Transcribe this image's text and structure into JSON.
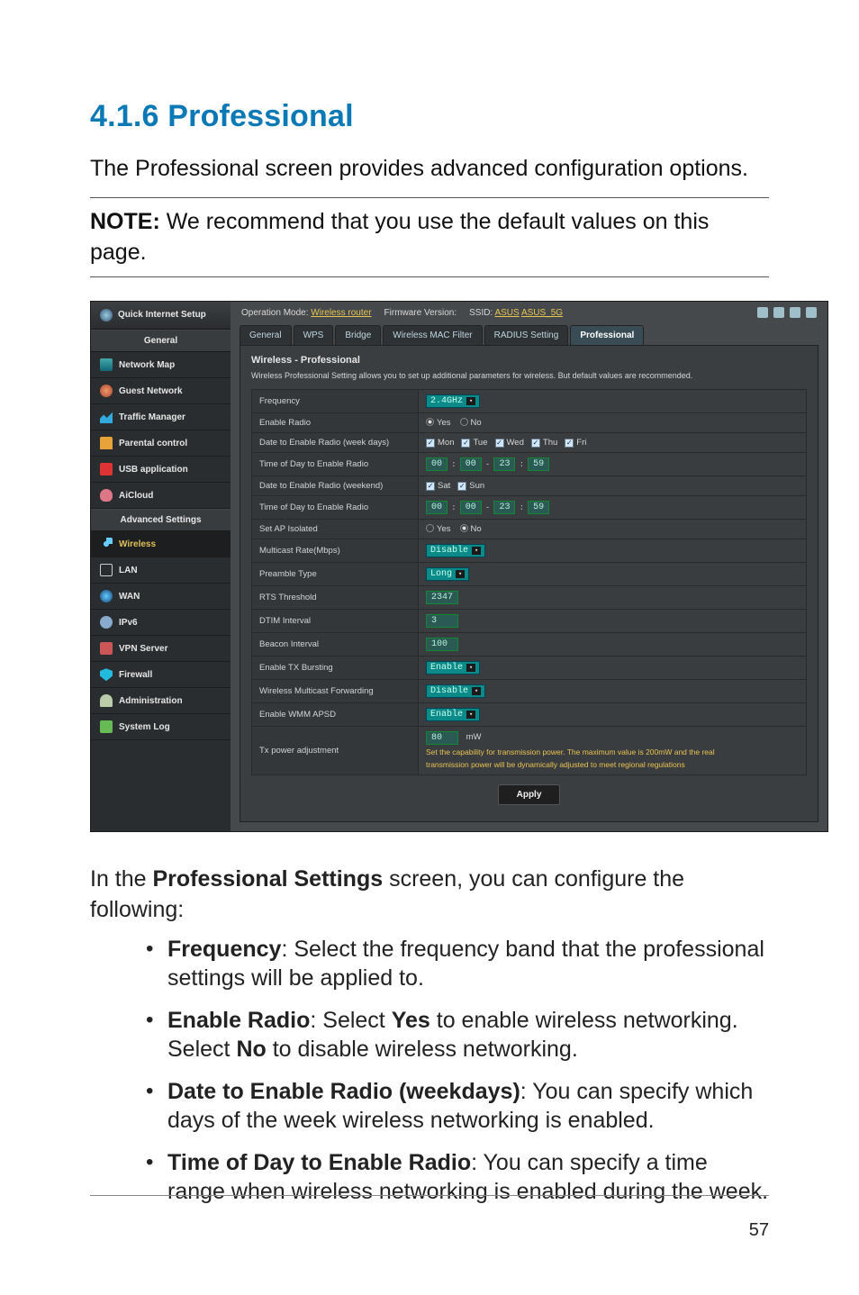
{
  "heading": "4.1.6 Professional",
  "intro": "The Professional screen provides advanced configuration options.",
  "note_label": "NOTE:",
  "note_body": "  We recommend that you use the default values on this page.",
  "page_number": "57",
  "ui": {
    "qis": "Quick Internet Setup",
    "group_general": "General",
    "group_advanced": "Advanced Settings",
    "nav": {
      "network_map": "Network Map",
      "guest_network": "Guest Network",
      "traffic_manager": "Traffic Manager",
      "parental": "Parental control",
      "usb": "USB application",
      "aicloud": "AiCloud",
      "wireless": "Wireless",
      "lan": "LAN",
      "wan": "WAN",
      "ipv6": "IPv6",
      "vpn": "VPN Server",
      "firewall": "Firewall",
      "admin": "Administration",
      "syslog": "System Log"
    },
    "top": {
      "op_mode_label": "Operation Mode:",
      "op_mode_value": "Wireless router",
      "fw_label": "Firmware Version:",
      "ssid_label": "SSID:",
      "ssid1": "ASUS",
      "ssid2": "ASUS_5G"
    },
    "tabs": {
      "general": "General",
      "wps": "WPS",
      "bridge": "Bridge",
      "macfilter": "Wireless MAC Filter",
      "radius": "RADIUS Setting",
      "professional": "Professional"
    },
    "panel_title": "Wireless - Professional",
    "panel_sub": "Wireless Professional Setting allows you to set up additional parameters for wireless. But default values are recommended.",
    "rows": {
      "frequency": {
        "label": "Frequency",
        "value": "2.4GHz"
      },
      "enable_radio": {
        "label": "Enable Radio",
        "yes": "Yes",
        "no": "No"
      },
      "date_week": {
        "label": "Date to Enable Radio (week days)",
        "mon": "Mon",
        "tue": "Tue",
        "wed": "Wed",
        "thu": "Thu",
        "fri": "Fri"
      },
      "time_week": {
        "label": "Time of Day to Enable Radio",
        "h1": "00",
        "m1": "00",
        "h2": "23",
        "m2": "59"
      },
      "date_weekend": {
        "label": "Date to Enable Radio (weekend)",
        "sat": "Sat",
        "sun": "Sun"
      },
      "time_weekend": {
        "label": "Time of Day to Enable Radio",
        "h1": "00",
        "m1": "00",
        "h2": "23",
        "m2": "59"
      },
      "ap_isolated": {
        "label": "Set AP Isolated",
        "yes": "Yes",
        "no": "No"
      },
      "multicast": {
        "label": "Multicast Rate(Mbps)",
        "value": "Disable"
      },
      "preamble": {
        "label": "Preamble Type",
        "value": "Long"
      },
      "rts": {
        "label": "RTS Threshold",
        "value": "2347"
      },
      "dtim": {
        "label": "DTIM Interval",
        "value": "3"
      },
      "beacon": {
        "label": "Beacon Interval",
        "value": "100"
      },
      "txburst": {
        "label": "Enable TX Bursting",
        "value": "Enable"
      },
      "wmf": {
        "label": "Wireless Multicast Forwarding",
        "value": "Disable"
      },
      "wmmapsd": {
        "label": "Enable WMM APSD",
        "value": "Enable"
      },
      "txpower": {
        "label": "Tx power adjustment",
        "value": "80",
        "unit": "mW",
        "hint1": "Set the capability for transmission power. The maximum value is 200mW and the real",
        "hint2": "transmission power will be dynamically adjusted to meet regional regulations"
      }
    },
    "apply": "Apply"
  },
  "follow": {
    "lead_prefix": "In the ",
    "lead_bold": "Professional Settings",
    "lead_suffix": " screen, you can configure the following:",
    "items": [
      {
        "bold": "Frequency",
        "rest": ":   Select the frequency band that the professional settings will be applied to."
      },
      {
        "bold": "Enable Radio",
        "rest": ":   Select ",
        "bold2": "Yes",
        "rest2": " to enable wireless networking. Select ",
        "bold3": "No",
        "rest3": " to disable wireless networking."
      },
      {
        "bold": "Date to Enable Radio (weekdays)",
        "rest": ":   You can specify which days of the week wireless networking is enabled."
      },
      {
        "bold": "Time of Day to Enable Radio",
        "rest": ":   You can specify a time range when wireless networking is enabled during the week."
      }
    ]
  }
}
